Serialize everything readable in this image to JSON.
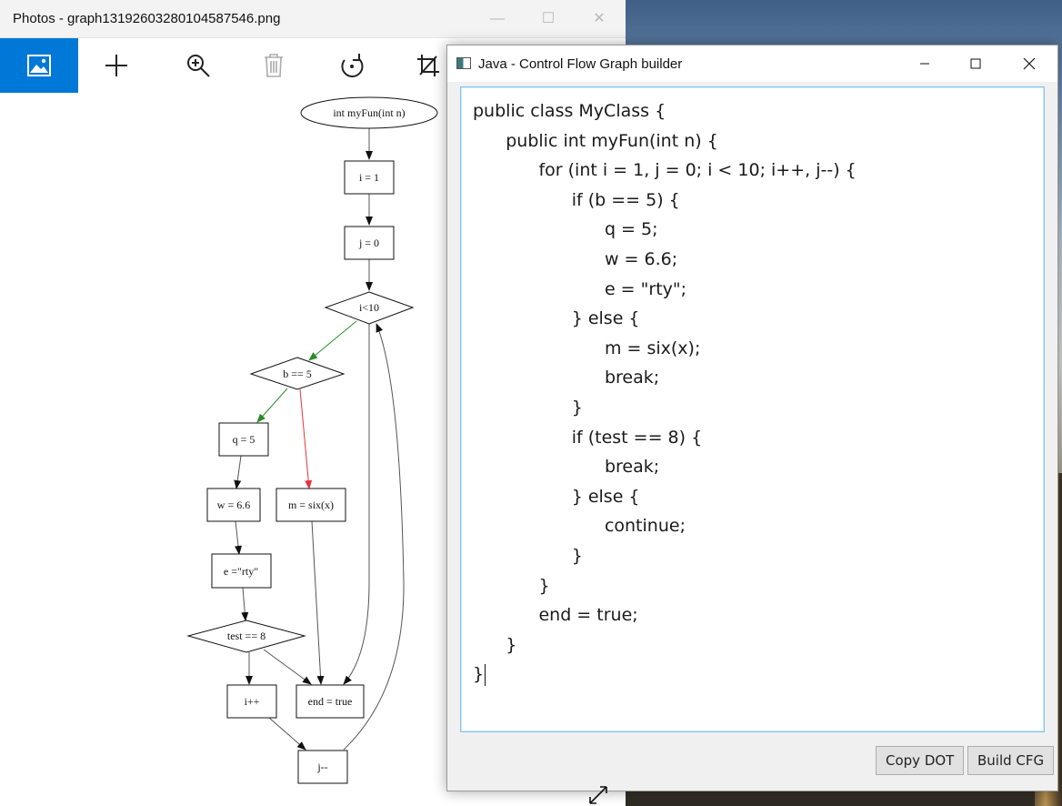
{
  "photos": {
    "title": "Photos - graph13192603280104587546.png",
    "controls": {
      "minimize": "—",
      "maximize": "☐",
      "close": "✕"
    },
    "toolbar": [
      {
        "name": "image-icon",
        "active": true
      },
      {
        "name": "add-icon"
      },
      {
        "name": "zoom-in-icon"
      },
      {
        "name": "delete-icon"
      },
      {
        "name": "rotate-icon"
      },
      {
        "name": "crop-icon"
      }
    ],
    "graph": {
      "nodes": {
        "start": "int myFun(int n)",
        "i1": "i = 1",
        "j0": "j = 0",
        "cond": "i<10",
        "b5": "b == 5",
        "q5": "q = 5",
        "w66": "w = 6.6",
        "msix": "m = six(x)",
        "erty": "e =\"rty\"",
        "test8": "test == 8",
        "iinc": "i++",
        "end": "end = true",
        "jdec": "j--"
      },
      "colors": {
        "true_edge": "#2a8a2a",
        "false_edge": "#e8323c",
        "edge": "#555555"
      }
    }
  },
  "cfg_window": {
    "title": "Java - Control Flow Graph builder",
    "controls": {
      "minimize": "—",
      "maximize": "☐",
      "close": "✕"
    },
    "code_lines": [
      "public class MyClass {",
      "      public int myFun(int n) {",
      "            for (int i = 1, j = 0; i < 10; i++, j--) {",
      "                  if (b == 5) {",
      "                        q = 5;",
      "                        w = 6.6;",
      "                        e = \"rty\";",
      "                  } else {",
      "                        m = six(x);",
      "                        break;",
      "                  }",
      "                  if (test == 8) {",
      "                        break;",
      "                  } else {",
      "                        continue;",
      "                  }",
      "            }",
      "            end = true;",
      "      }",
      "}"
    ],
    "buttons": {
      "copy_dot": "Copy DOT",
      "build_cfg": "Build CFG"
    },
    "accent": "#0078d7"
  }
}
